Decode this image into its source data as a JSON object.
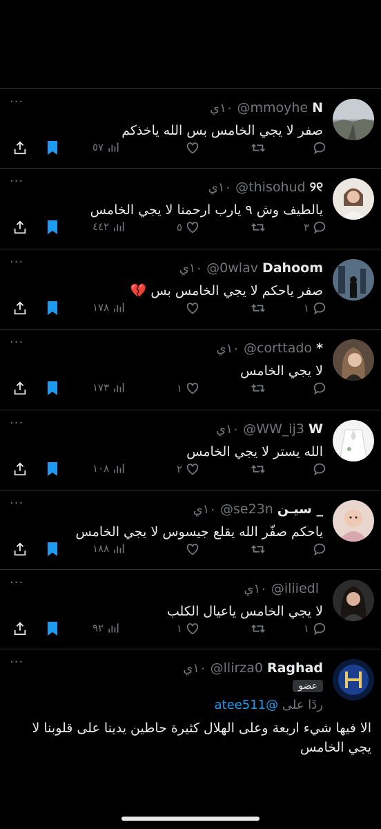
{
  "colors": {
    "accent": "#1d9bf0",
    "muted": "#71767b",
    "text": "#e7e9ea",
    "divider": "#2f3336"
  },
  "more_label": "···",
  "tweets": [
    {
      "name": "N",
      "handle": "@mmoyhe",
      "time": "١٠ي",
      "text": "صفر لا يجي الخامس بس الله ياخذكم",
      "replies": "",
      "retweets": "",
      "likes": "",
      "views": "٥٧",
      "avatar": "landscape"
    },
    {
      "name": "୨୧",
      "handle": "@thisohud",
      "time": "١٠ي",
      "text": "يالطيف وش ٩ يارب ارحمنا لا يجي الخامس",
      "replies": "٣",
      "retweets": "",
      "likes": "٥",
      "views": "٤٤٢",
      "avatar": "girl-mirror"
    },
    {
      "name": "Dahoom",
      "handle": "@0wlav",
      "time": "١٠ي",
      "text": "صفر ياحكم لا يجي الخامس بس 💔",
      "replies": "١",
      "retweets": "",
      "likes": "",
      "views": "١٧٨",
      "avatar": "city-window"
    },
    {
      "name": "*",
      "handle": "@corttado",
      "time": "١٠ي",
      "text": "لا يجي الخامس",
      "replies": "",
      "retweets": "",
      "likes": "١",
      "views": "١٧٣",
      "avatar": "girl-portrait"
    },
    {
      "name": "W",
      "handle": "@WW_ij3",
      "time": "١٠ي",
      "text": "الله يستر لا يجي الخامس",
      "replies": "",
      "retweets": "",
      "likes": "٢",
      "views": "١٠٨",
      "avatar": "white-shirt"
    },
    {
      "name": "سيـن _",
      "handle": "@se23n",
      "time": "١٠ي",
      "text": "ياحكم صفّر الله يقلع جيسوس لا يجي الخامس",
      "replies": "",
      "retweets": "",
      "likes": "",
      "views": "١٨٨",
      "avatar": "baby"
    },
    {
      "name": "",
      "handle": "@iliiedl",
      "time": "١٠ي",
      "text": "لا يجي الخامس ياعيال الكلب",
      "replies": "١",
      "retweets": "",
      "likes": "١",
      "views": "٩٢",
      "avatar": "girl-dark"
    }
  ],
  "last_tweet": {
    "name": "Raghad",
    "handle": "@llirza0",
    "time": "١٠ي",
    "badge": "عضو",
    "reply_prefix": "ردًا على",
    "reply_mention": "@atee511",
    "text": "الا فيها شيء اربعة وعلى الهلال كثيرة حاطين يدينا على قلوبنا لا يجي الخامس",
    "avatar": "alhilal-logo"
  }
}
